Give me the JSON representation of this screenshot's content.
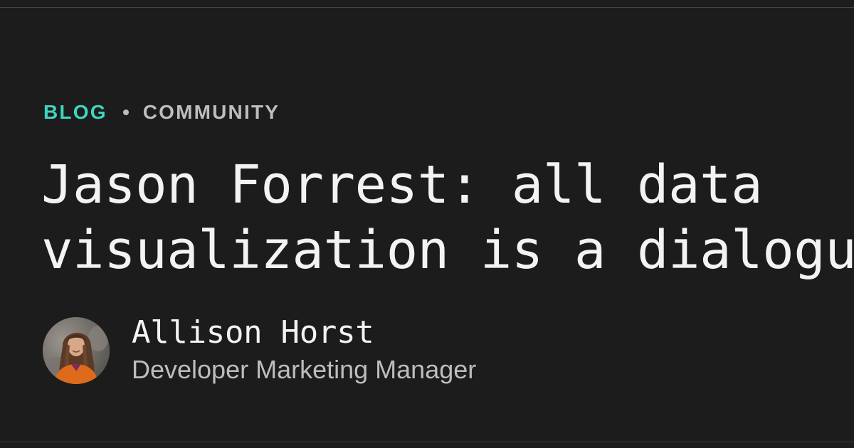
{
  "eyebrow": {
    "section": "BLOG",
    "category": "COMMUNITY"
  },
  "title": {
    "line1": "Jason Forrest: all data",
    "line2": "visualization is a dialogue"
  },
  "author": {
    "name": "Allison Horst",
    "role": "Developer Marketing Manager"
  },
  "colors": {
    "background": "#1c1c1c",
    "accent": "#3fd4c0",
    "text_primary": "#f3f3f3",
    "text_secondary": "#bdbdbd"
  }
}
